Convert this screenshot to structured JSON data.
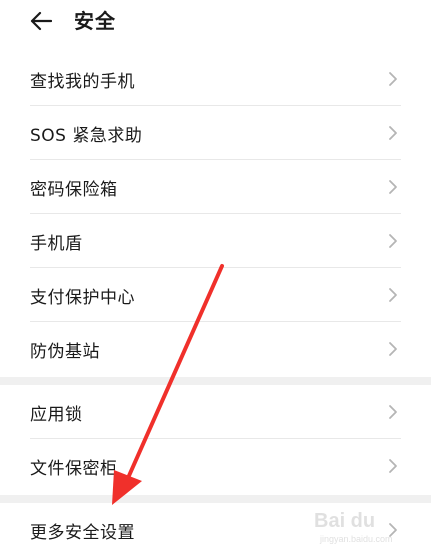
{
  "header": {
    "title": "安全",
    "back_icon": "arrow-left-icon"
  },
  "groups": [
    {
      "items": [
        {
          "label": "查找我的手机"
        },
        {
          "label": "SOS 紧急求助"
        },
        {
          "label": "密码保险箱"
        },
        {
          "label": "手机盾"
        },
        {
          "label": "支付保护中心"
        },
        {
          "label": "防伪基站"
        }
      ]
    },
    {
      "items": [
        {
          "label": "应用锁"
        },
        {
          "label": "文件保密柜"
        }
      ]
    },
    {
      "items": [
        {
          "label": "更多安全设置"
        }
      ]
    }
  ],
  "annotation": {
    "arrow_color": "#f0302b"
  },
  "watermark": {
    "text": "Bai du",
    "sub": "jingyan.baidu.com"
  }
}
